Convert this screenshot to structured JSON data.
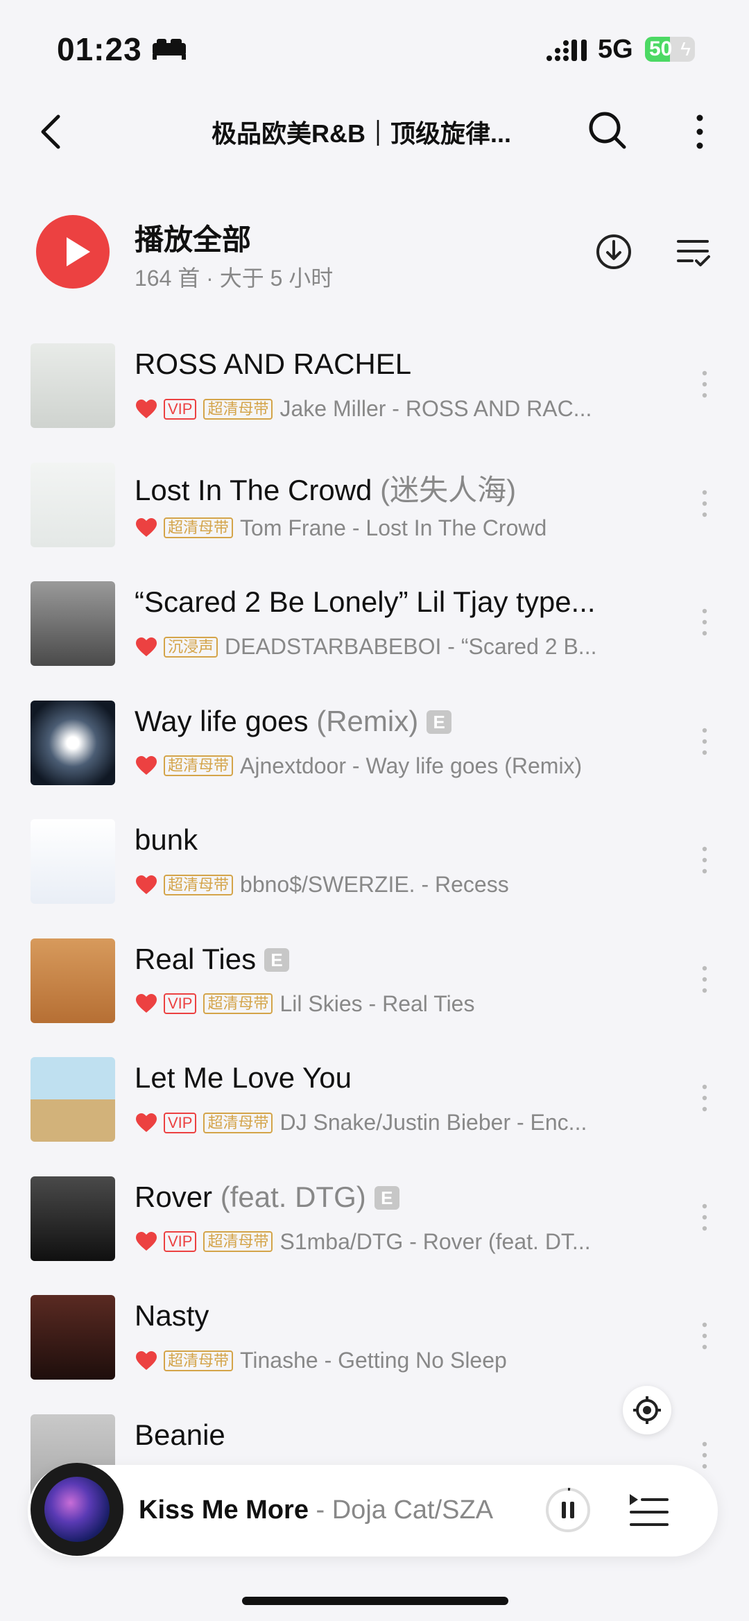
{
  "status": {
    "time": "01:23",
    "network": "5G",
    "battery": "50",
    "battery_level": 0.5
  },
  "header": {
    "title": "极品欧美R&B｜顶级旋律..."
  },
  "play_all": {
    "label": "播放全部",
    "summary": "164 首 · 大于 5 小时"
  },
  "songs": [
    {
      "title": "ROSS AND RACHEL",
      "subtitle": "",
      "explicit": false,
      "tags": [
        "VIP",
        "超清母带"
      ],
      "meta": "Jake Miller - ROSS AND RAC..."
    },
    {
      "title": "Lost In The Crowd",
      "subtitle": "(迷失人海)",
      "explicit": false,
      "tags": [
        "超清母带"
      ],
      "meta": "Tom Frane - Lost In The Crowd"
    },
    {
      "title": "“Scared 2 Be Lonely” Lil Tjay type...",
      "subtitle": "",
      "explicit": false,
      "tags": [
        "沉浸声"
      ],
      "meta": "DEADSTARBABEBOI - “Scared 2 B..."
    },
    {
      "title": "Way life goes",
      "subtitle": "(Remix)",
      "explicit": true,
      "tags": [
        "超清母带"
      ],
      "meta": "Ajnextdoor - Way life goes (Remix)"
    },
    {
      "title": "bunk",
      "subtitle": "",
      "explicit": false,
      "tags": [
        "超清母带"
      ],
      "meta": "bbno$/SWERZIE. - Recess"
    },
    {
      "title": "Real Ties",
      "subtitle": "",
      "explicit": true,
      "tags": [
        "VIP",
        "超清母带"
      ],
      "meta": "Lil Skies - Real Ties"
    },
    {
      "title": "Let Me Love You",
      "subtitle": "",
      "explicit": false,
      "tags": [
        "VIP",
        "超清母带"
      ],
      "meta": "DJ Snake/Justin Bieber - Enc..."
    },
    {
      "title": "Rover",
      "subtitle": "(feat. DTG)",
      "explicit": true,
      "tags": [
        "VIP",
        "超清母带"
      ],
      "meta": "S1mba/DTG - Rover (feat. DT..."
    },
    {
      "title": "Nasty",
      "subtitle": "",
      "explicit": false,
      "tags": [
        "超清母带"
      ],
      "meta": "Tinashe - Getting No Sleep"
    },
    {
      "title": "Beanie",
      "subtitle": "",
      "explicit": false,
      "tags": [],
      "meta": ""
    }
  ],
  "explicit_label": "E",
  "now_playing": {
    "title": "Kiss Me More",
    "artist": " - Doja Cat/SZA"
  },
  "colors": {
    "accent": "#ec4141",
    "hq_tag": "#d4a449"
  },
  "icons": [
    "back-icon",
    "search-icon",
    "more-vertical-icon",
    "play-icon",
    "download-icon",
    "multi-select-icon",
    "heart-icon",
    "locate-icon",
    "pause-icon",
    "playlist-queue-icon"
  ]
}
